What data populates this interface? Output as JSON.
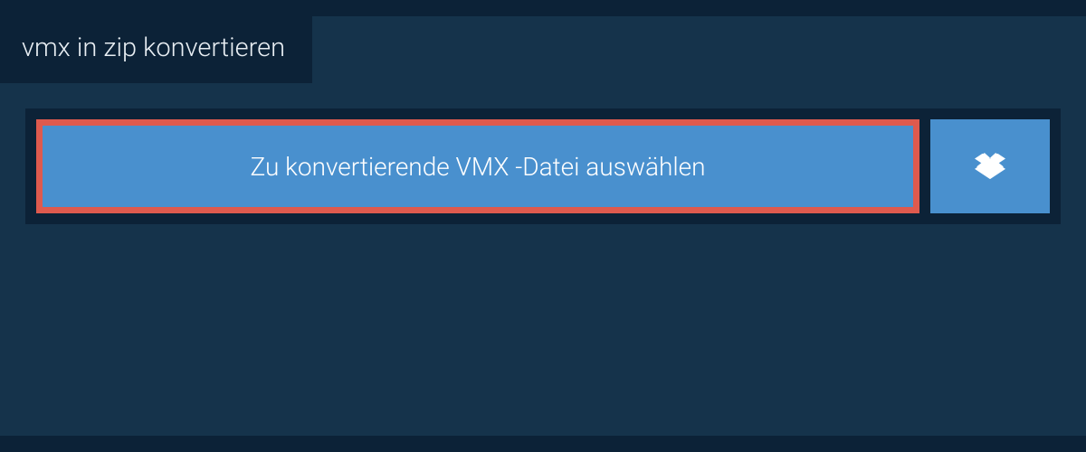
{
  "header": {
    "title": "vmx in zip konvertieren"
  },
  "upload": {
    "select_label": "Zu konvertierende VMX -Datei auswählen",
    "dropbox_icon": "dropbox"
  },
  "colors": {
    "page_bg": "#15334b",
    "panel_bg": "#0c2237",
    "button_bg": "#4990ce",
    "highlight_border": "#de5a4e"
  }
}
